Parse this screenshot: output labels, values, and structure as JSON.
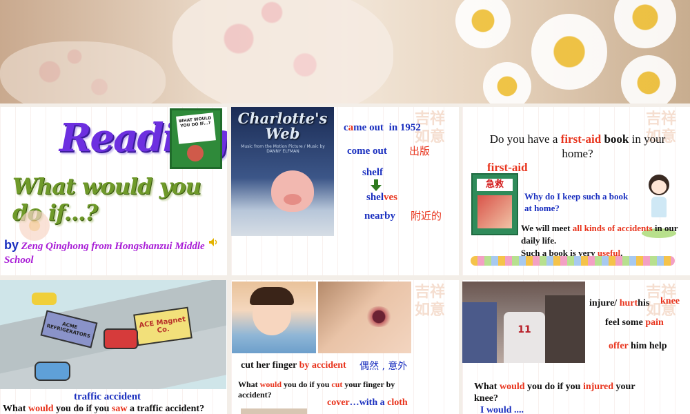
{
  "slide1": {
    "title": "Reading",
    "subtitle": "What would you do if...?",
    "by": "by",
    "author": "Zeng Qinghong from Hongshanzui Middle School",
    "book_cover_text": "WHAT WOULD YOU DO IF...?"
  },
  "slide2": {
    "poster_title": "Charlotte's Web",
    "poster_caption": "Music from the Motion Picture / Music by DANNY ELFMAN",
    "came_out_c": "c",
    "came_out_a": "a",
    "came_out_rest": "me out",
    "came_out_year": "in 1952",
    "come_out": "come out",
    "come_out_cn": "出版",
    "shelf": "shelf",
    "shelves_a": "shel",
    "shelves_b": "ves",
    "nearby": "nearby",
    "nearby_cn": "附近的"
  },
  "slide3": {
    "question_pre": "Do you have a ",
    "question_first_aid": "first-aid",
    "question_book": " book",
    "question_post": " in your home?",
    "first_aid_label": "first-aid",
    "book_cn": "急救",
    "why": "Why do I keep such a book at home?",
    "meet_pre": "We will meet ",
    "meet_all_kinds": "all kinds of accidents",
    "meet_post": " in our daily life.",
    "useful_pre": "Such a book is very ",
    "useful": "useful",
    "useful_post": "."
  },
  "slide4": {
    "truck_left": "ACME REFRIGERATORS",
    "truck_right": "ACE Magnet Co.",
    "label": "traffic accident",
    "q_what": "What ",
    "q_would": "would",
    "q_mid": " you do if you ",
    "q_saw": "saw",
    "q_post": " a traffic accident?"
  },
  "slide5": {
    "cut_pre": "cut her finger ",
    "by_accident": "by accident",
    "by_accident_cn": "偶然 , 意外",
    "q_what": "What ",
    "q_would": "would",
    "q_mid": " you do if you ",
    "q_cut": "cut",
    "q_post": " your finger by accident?",
    "cover": "cover",
    "with_a": "…with a ",
    "cloth": "cloth"
  },
  "slide6": {
    "injure": "injure/ ",
    "hurt": "hurt",
    "his": "his",
    "knee": "knee",
    "feel_some": "feel some ",
    "pain": "pain",
    "offer": "offer",
    "him_help": " him help",
    "jersey_number": "11",
    "q_what": "What ",
    "q_would": "would",
    "q_mid": " you do if you ",
    "q_injured": "injured",
    "q_post": " your knee?",
    "answer": "I would ...."
  },
  "watermark": "吉祥\n如意",
  "colors": {
    "blue": "#1a2fbf",
    "red": "#e8331c",
    "purple": "#a81bd6",
    "reading": "#6d2fe0",
    "subtitle": "#6f9a2a"
  }
}
